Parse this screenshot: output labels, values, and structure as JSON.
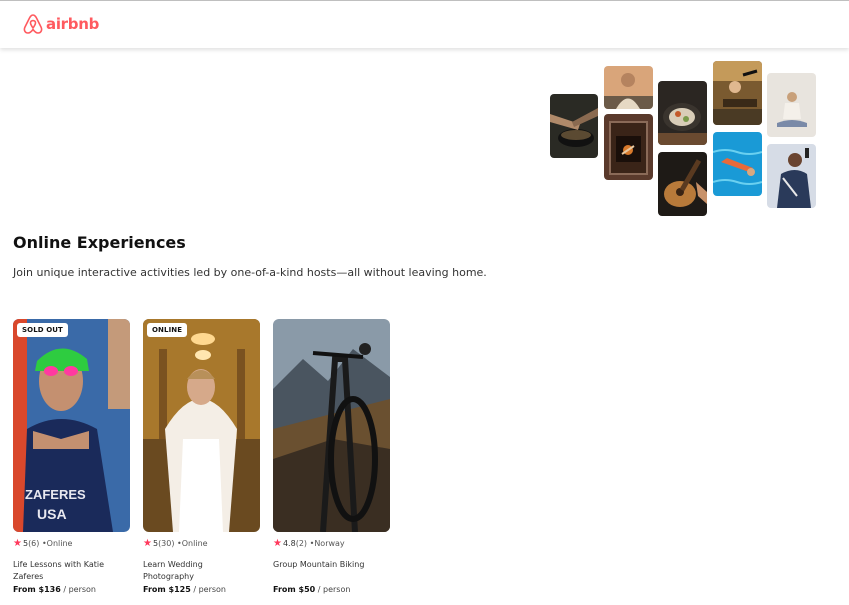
{
  "header": {
    "brand": "airbnb",
    "brand_color": "#ff5a5f"
  },
  "hero": {
    "collage_icons": [
      "cooking-photo-icon",
      "portrait-photo-icon",
      "fireplace-photo-icon",
      "bowl-food-photo-icon",
      "guitar-photo-icon",
      "performer-photo-icon",
      "swimmer-photo-icon",
      "yoga-photo-icon",
      "singer-photo-icon"
    ]
  },
  "section": {
    "title": "Online Experiences",
    "subtitle": "Join unique interactive activities led by one-of-a-kind hosts—all without leaving home."
  },
  "cards": [
    {
      "badge": "SOLD OUT",
      "rating": "5",
      "reviews": "(6)",
      "location": "•Online",
      "title": "Life Lessons with Katie Zaferes",
      "price": "From $136",
      "unit": " / person"
    },
    {
      "badge": "ONLINE",
      "rating": "5",
      "reviews": "(30)",
      "location": "•Online",
      "title": "Learn Wedding Photography",
      "price": "From $125",
      "unit": " / person"
    },
    {
      "badge": "",
      "rating": "4.8",
      "reviews": "(2)",
      "location": "•Norway",
      "title": "Group Mountain Biking",
      "price": "From $50",
      "unit": " / person"
    }
  ],
  "colors": {
    "star": "#ff385c"
  }
}
